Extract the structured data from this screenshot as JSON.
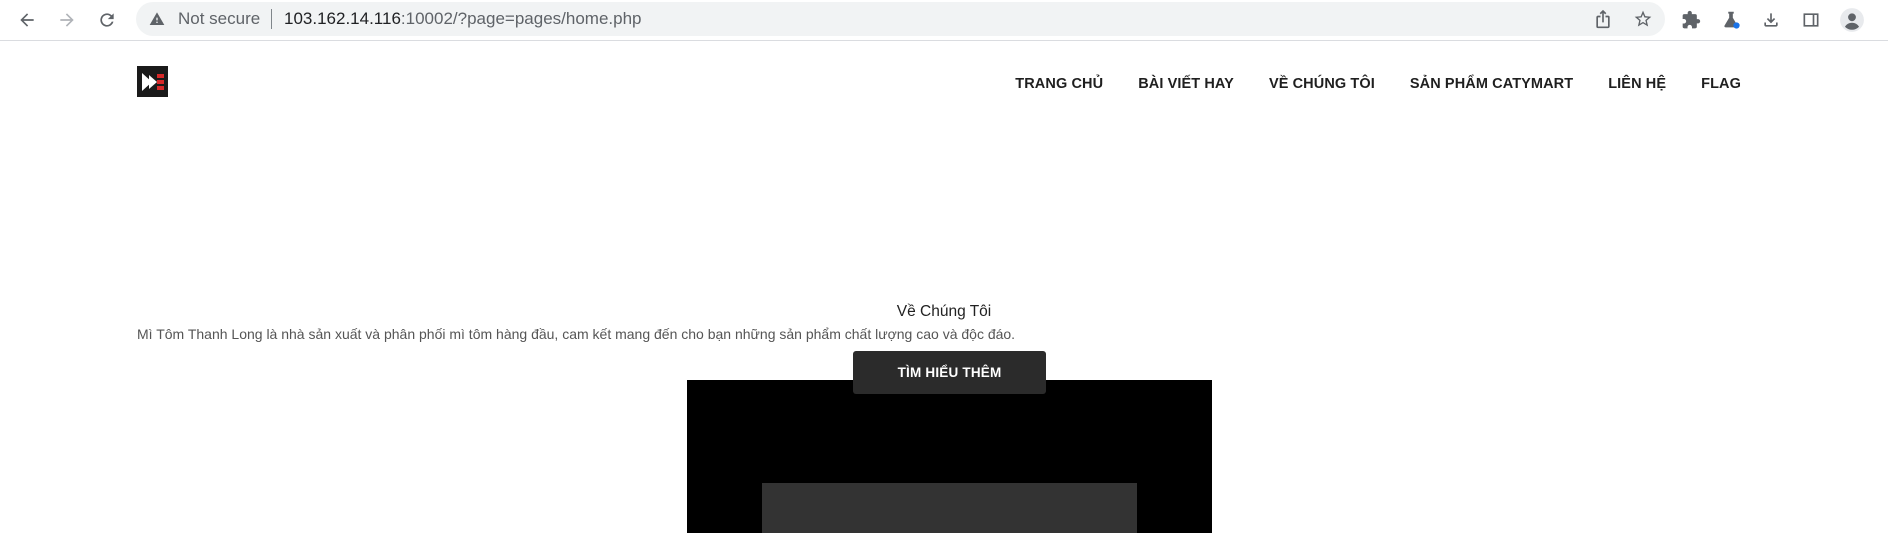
{
  "browser": {
    "security_label": "Not secure",
    "url_host": "103.162.14.116",
    "url_rest": ":10002/?page=pages/home.php",
    "icons": {
      "back": "back-arrow-icon",
      "forward": "forward-arrow-icon",
      "reload": "reload-icon",
      "warning": "warning-triangle-icon",
      "share": "share-icon",
      "bookmark": "star-icon",
      "extensions": "puzzle-icon",
      "labs": "flask-icon",
      "download": "download-icon",
      "sidepanel": "side-panel-icon",
      "profile": "profile-icon"
    },
    "accent": "#1a73e8"
  },
  "site": {
    "nav": [
      {
        "label": "TRANG CHỦ"
      },
      {
        "label": "BÀI VIẾT HAY"
      },
      {
        "label": "VỀ CHÚNG TÔI"
      },
      {
        "label": "SẢN PHẨM CATYMART"
      },
      {
        "label": "LIÊN HỆ"
      },
      {
        "label": "FLAG"
      }
    ],
    "about": {
      "title": "Về Chúng Tôi",
      "description": "Mì Tôm Thanh Long là nhà sản xuất và phân phối mì tôm hàng đầu, cam kết mang đến cho bạn những sản phẩm chất lượng cao và độc đáo.",
      "cta_label": "TÌM HIỂU THÊM"
    }
  }
}
